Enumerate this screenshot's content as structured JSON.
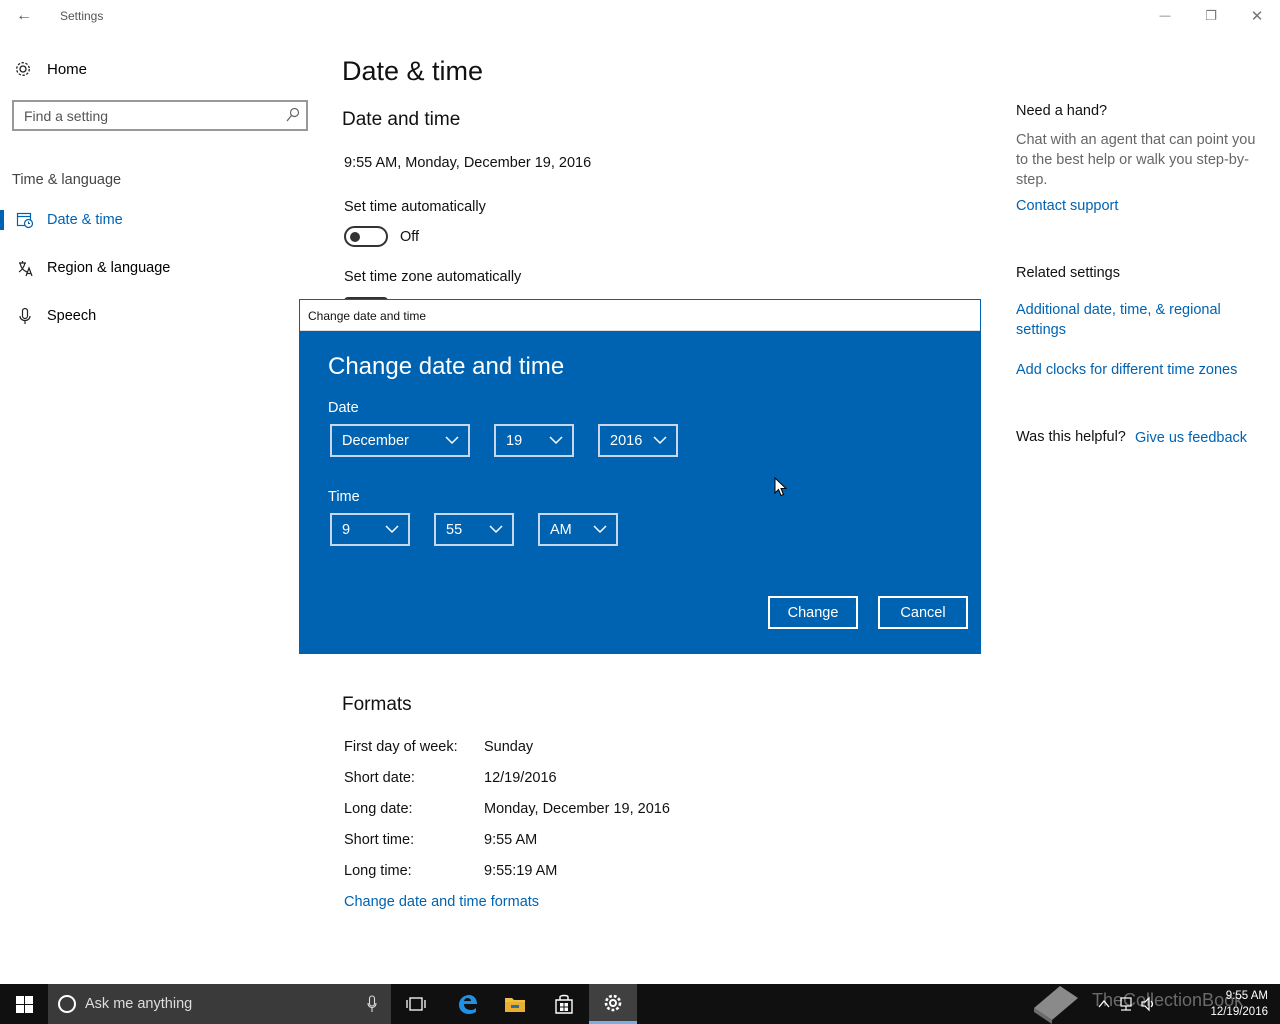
{
  "window": {
    "title": "Settings",
    "back_glyph": "←",
    "minimize_glyph": "—",
    "restore_glyph": "❐",
    "close_glyph": "✕"
  },
  "nav": {
    "home_label": "Home",
    "search_placeholder": "Find a setting",
    "group_label": "Time & language",
    "items": [
      {
        "label": "Date & time",
        "icon": "calendar-clock-icon",
        "selected": true
      },
      {
        "label": "Region & language",
        "icon": "region-language-icon",
        "selected": false
      },
      {
        "label": "Speech",
        "icon": "microphone-icon",
        "selected": false
      }
    ]
  },
  "main": {
    "page_title": "Date & time",
    "section_title": "Date and time",
    "current_datetime": "9:55 AM, Monday, December 19, 2016",
    "set_time_auto_label": "Set time automatically",
    "set_time_auto_state": "Off",
    "set_timezone_auto_label": "Set time zone automatically",
    "formats": {
      "title": "Formats",
      "rows": [
        {
          "label": "First day of week:",
          "value": "Sunday"
        },
        {
          "label": "Short date:",
          "value": "12/19/2016"
        },
        {
          "label": "Long date:",
          "value": "Monday, December 19, 2016"
        },
        {
          "label": "Short time:",
          "value": "9:55 AM"
        },
        {
          "label": "Long time:",
          "value": "9:55:19 AM"
        }
      ],
      "change_link": "Change date and time formats"
    }
  },
  "right_pane": {
    "help_heading": "Need a hand?",
    "help_text": "Chat with an agent that can point you to the best help or walk you step-by-step.",
    "contact_link": "Contact support",
    "related_heading": "Related settings",
    "related_link_1": "Additional date, time, & regional settings",
    "related_link_2": "Add clocks for different time zones",
    "helpful_question": "Was this helpful?",
    "feedback_link": "Give us feedback"
  },
  "dialog": {
    "window_title": "Change date and time",
    "heading": "Change date and time",
    "date_label": "Date",
    "month": "December",
    "day": "19",
    "year": "2016",
    "time_label": "Time",
    "hour": "9",
    "minute": "55",
    "ampm": "AM",
    "change_button": "Change",
    "cancel_button": "Cancel"
  },
  "taskbar": {
    "search_placeholder": "Ask me anything",
    "watermark": "TheCollectionBook",
    "clock_time": "9:55 AM",
    "clock_date": "12/19/2016"
  },
  "colors": {
    "accent": "#0063b1",
    "taskbar": "#101010"
  }
}
